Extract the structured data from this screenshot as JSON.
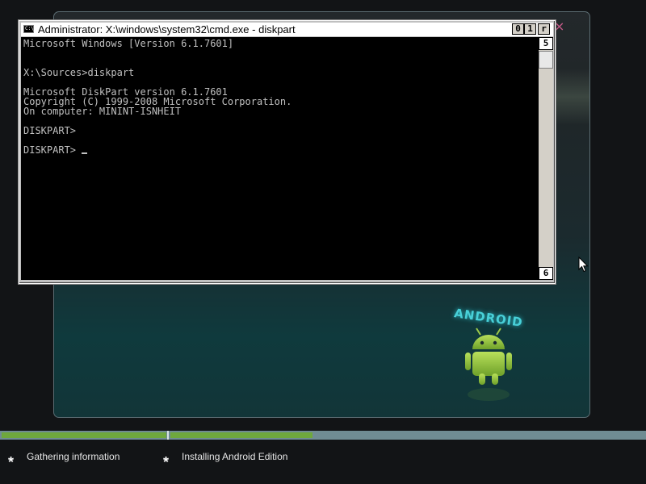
{
  "cmd_window": {
    "title": "Administrator: X:\\windows\\system32\\cmd.exe - diskpart",
    "icon_label": "C:\\",
    "buttons": {
      "minimize": "0",
      "maximize": "1",
      "close": "r"
    },
    "scrollbar": {
      "up": "5",
      "down": "6"
    },
    "console_lines": [
      "Microsoft Windows [Version 6.1.7601]",
      "",
      "",
      "X:\\Sources>diskpart",
      "",
      "Microsoft DiskPart version 6.1.7601",
      "Copyright (C) 1999-2008 Microsoft Corporation.",
      "On computer: MININT-ISNHEIT",
      "",
      "DISKPART>",
      "",
      "DISKPART> "
    ]
  },
  "setup_window": {
    "close_glyph": "×",
    "logo_text": "ANDROID"
  },
  "progress": {
    "stage1_fraction": 1.0,
    "stage2_fraction": 0.3,
    "accent_color": "#6fa83d"
  },
  "status": {
    "items": [
      {
        "label": "Gathering information",
        "icon": "asterisk-icon"
      },
      {
        "label": "Installing Android Edition",
        "icon": "asterisk-icon"
      }
    ]
  }
}
